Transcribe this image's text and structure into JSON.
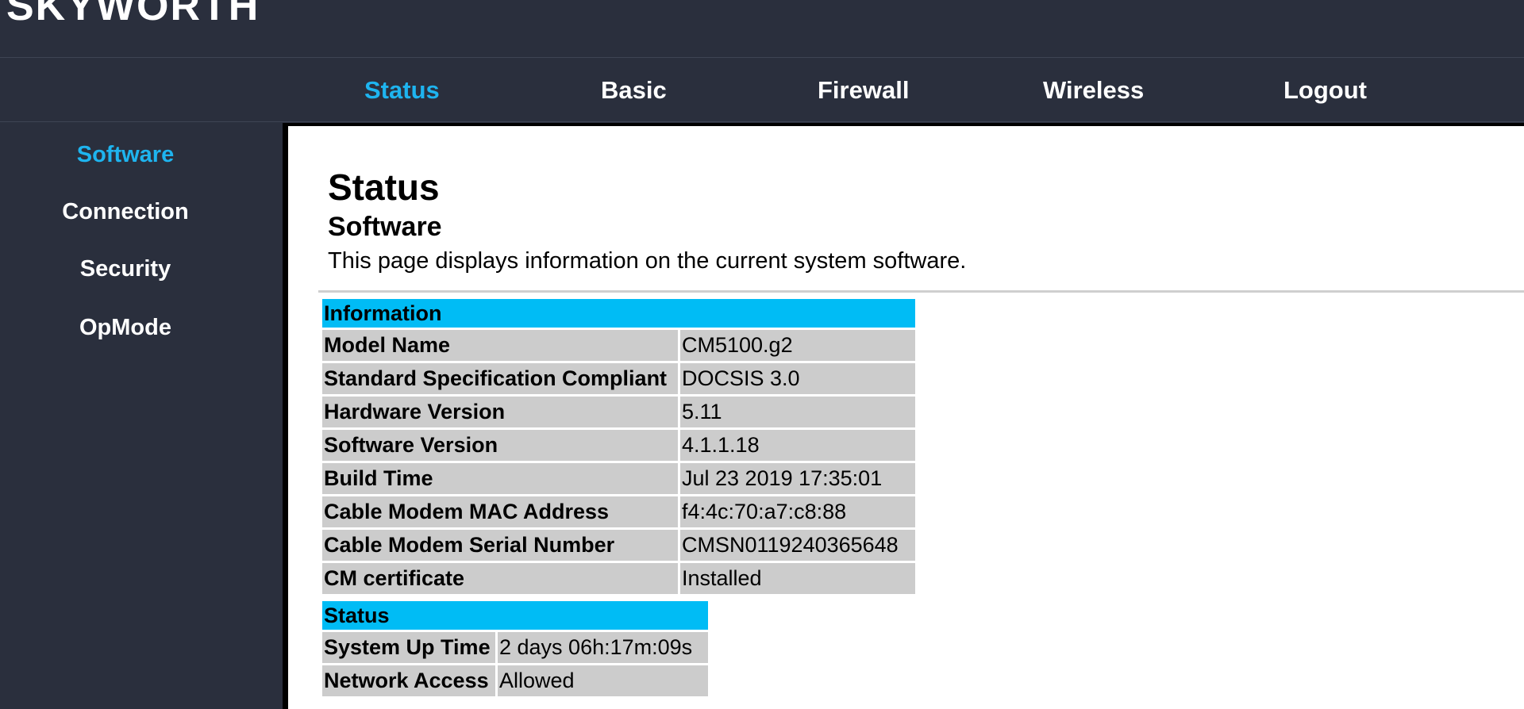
{
  "brand": "SKYWORTH",
  "topnav": [
    {
      "label": "Status",
      "active": true
    },
    {
      "label": "Basic",
      "active": false
    },
    {
      "label": "Firewall",
      "active": false
    },
    {
      "label": "Wireless",
      "active": false
    },
    {
      "label": "Logout",
      "active": false
    }
  ],
  "sidebar": [
    {
      "label": "Software",
      "active": true
    },
    {
      "label": "Connection",
      "active": false
    },
    {
      "label": "Security",
      "active": false
    },
    {
      "label": "OpMode",
      "active": false
    }
  ],
  "main": {
    "title": "Status",
    "subtitle": "Software",
    "description": "This page displays information on the current system software."
  },
  "information": {
    "header": "Information",
    "rows": [
      {
        "label": "Model Name",
        "value": "CM5100.g2"
      },
      {
        "label": "Standard Specification Compliant",
        "value": "DOCSIS 3.0"
      },
      {
        "label": "Hardware Version",
        "value": "5.11"
      },
      {
        "label": "Software Version",
        "value": "4.1.1.18"
      },
      {
        "label": "Build Time",
        "value": "Jul 23 2019 17:35:01"
      },
      {
        "label": "Cable Modem MAC Address",
        "value": "f4:4c:70:a7:c8:88"
      },
      {
        "label": "Cable Modem Serial Number",
        "value": "CMSN0119240365648"
      },
      {
        "label": "CM certificate",
        "value": "Installed"
      }
    ]
  },
  "status": {
    "header": "Status",
    "rows": [
      {
        "label": "System Up Time",
        "value": "2 days 06h:17m:09s"
      },
      {
        "label": "Network Access",
        "value": "Allowed"
      }
    ]
  },
  "colors": {
    "accent": "#1eb4ef",
    "table_header": "#00bcf5",
    "background": "#2a2f3d"
  }
}
